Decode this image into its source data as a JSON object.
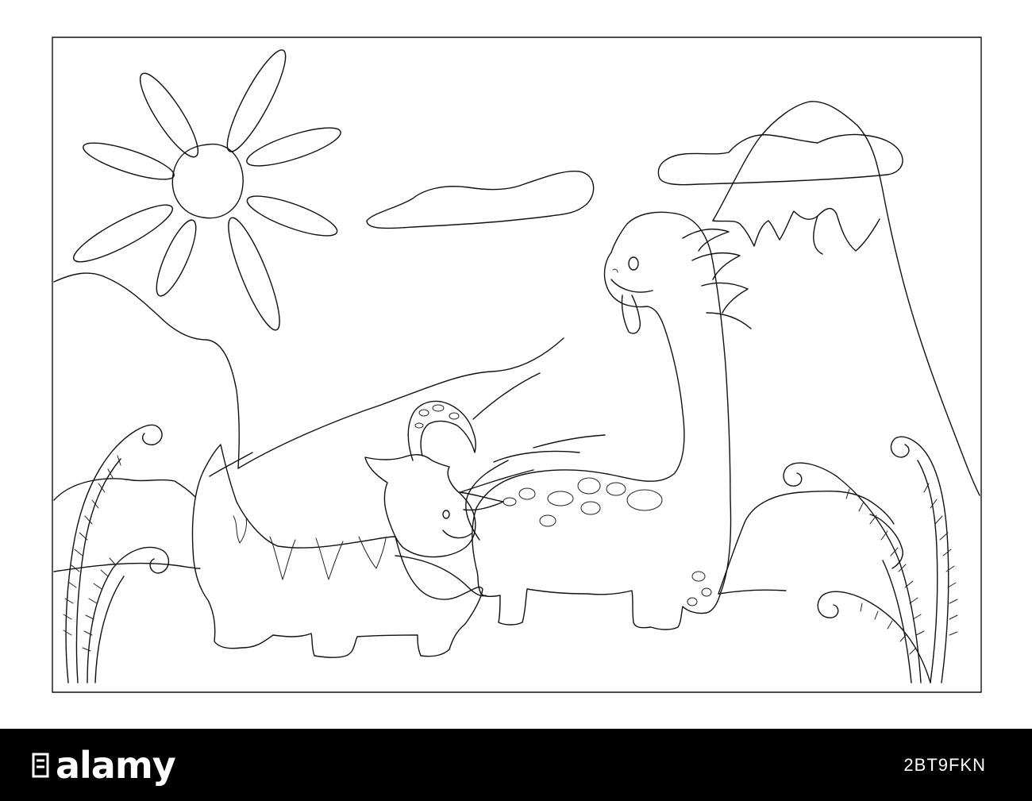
{
  "watermark": {
    "brand": "alamy",
    "image_id": "2BT9FKN",
    "background_color": "#000000",
    "text_color": "#ffffff"
  },
  "artwork": {
    "style": "black-and-white coloring page",
    "line_color": "#111111",
    "background_color": "#ffffff"
  }
}
